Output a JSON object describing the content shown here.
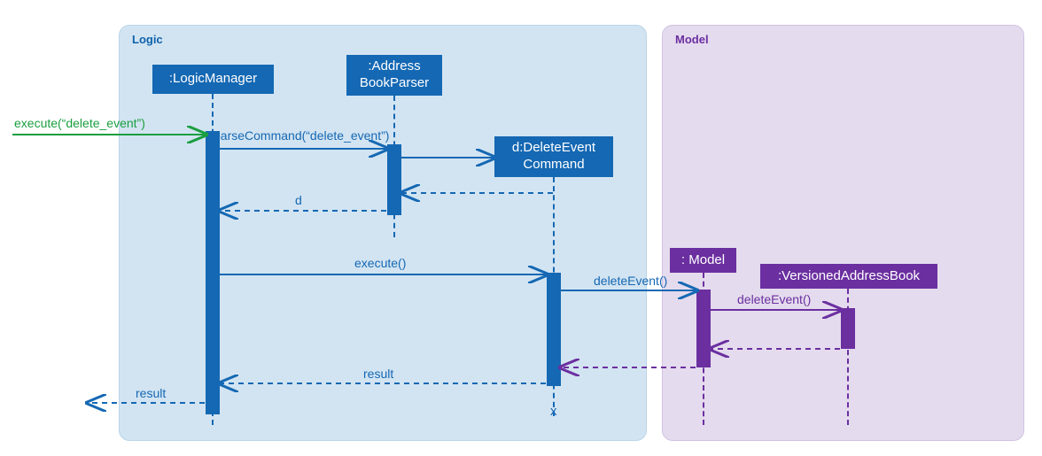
{
  "regions": {
    "logic_label": "Logic",
    "model_label": "Model"
  },
  "objects": {
    "logic_manager": ":LogicManager",
    "address_book_parser": ":Address\nBookParser",
    "delete_event_cmd": "d:DeleteEvent\nCommand",
    "model": ": Model",
    "versioned_ab": ":VersionedAddressBook"
  },
  "messages": {
    "execute_in": "execute(“delete_event”)",
    "parse_cmd": "parseCommand(“delete_event”)",
    "return_d": "d",
    "execute": "execute()",
    "delete_event1": "deleteEvent()",
    "delete_event2": "deleteEvent()",
    "result1": "result",
    "result2": "result",
    "destroy": "x"
  },
  "chart_data": {
    "type": "sequence-diagram",
    "frames": [
      {
        "name": "Logic",
        "participants": [
          ":LogicManager",
          ":AddressBookParser",
          "d:DeleteEventCommand"
        ]
      },
      {
        "name": "Model",
        "participants": [
          ": Model",
          ":VersionedAddressBook"
        ]
      }
    ],
    "participants": [
      {
        "id": "LogicManager",
        "label": ":LogicManager",
        "frame": "Logic"
      },
      {
        "id": "AddressBookParser",
        "label": ":AddressBookParser",
        "frame": "Logic"
      },
      {
        "id": "DeleteEventCommand",
        "label": "d:DeleteEventCommand",
        "frame": "Logic",
        "created_by_message": 2
      },
      {
        "id": "Model",
        "label": ": Model",
        "frame": "Model"
      },
      {
        "id": "VersionedAddressBook",
        "label": ":VersionedAddressBook",
        "frame": "Model"
      }
    ],
    "messages": [
      {
        "n": 1,
        "from": "external",
        "to": "LogicManager",
        "label": "execute(“delete_event”)",
        "kind": "call"
      },
      {
        "n": 2,
        "from": "LogicManager",
        "to": "AddressBookParser",
        "label": "parseCommand(“delete_event”)",
        "kind": "call"
      },
      {
        "n": 3,
        "from": "AddressBookParser",
        "to": "DeleteEventCommand",
        "label": "",
        "kind": "create"
      },
      {
        "n": 4,
        "from": "DeleteEventCommand",
        "to": "AddressBookParser",
        "label": "",
        "kind": "return"
      },
      {
        "n": 5,
        "from": "AddressBookParser",
        "to": "LogicManager",
        "label": "d",
        "kind": "return"
      },
      {
        "n": 6,
        "from": "LogicManager",
        "to": "DeleteEventCommand",
        "label": "execute()",
        "kind": "call"
      },
      {
        "n": 7,
        "from": "DeleteEventCommand",
        "to": "Model",
        "label": "deleteEvent()",
        "kind": "call"
      },
      {
        "n": 8,
        "from": "Model",
        "to": "VersionedAddressBook",
        "label": "deleteEvent()",
        "kind": "call"
      },
      {
        "n": 9,
        "from": "VersionedAddressBook",
        "to": "Model",
        "label": "",
        "kind": "return"
      },
      {
        "n": 10,
        "from": "Model",
        "to": "DeleteEventCommand",
        "label": "",
        "kind": "return"
      },
      {
        "n": 11,
        "from": "DeleteEventCommand",
        "to": "LogicManager",
        "label": "result",
        "kind": "return"
      },
      {
        "n": 12,
        "from": "LogicManager",
        "to": "external",
        "label": "result",
        "kind": "return"
      },
      {
        "n": 13,
        "on": "DeleteEventCommand",
        "kind": "destroy"
      }
    ]
  }
}
